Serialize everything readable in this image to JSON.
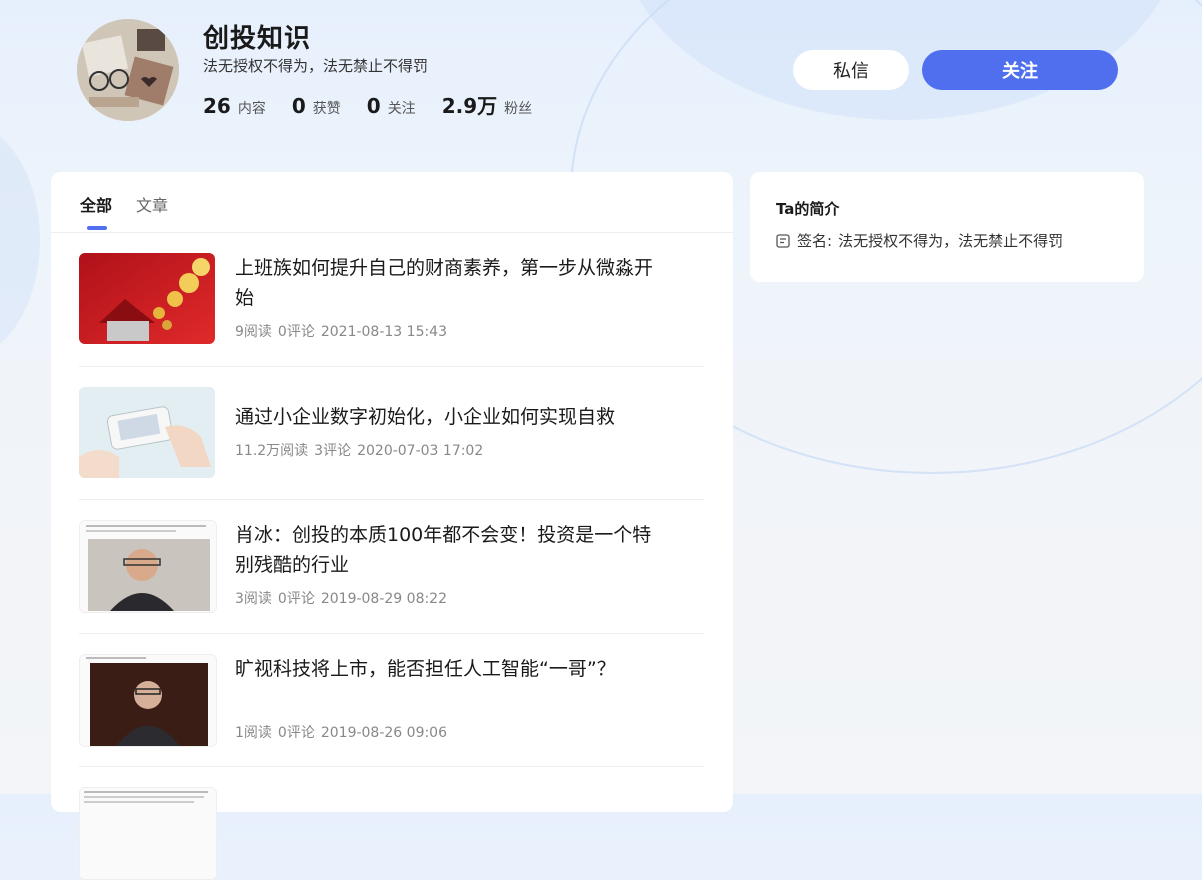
{
  "profile": {
    "name": "创投知识",
    "signature": "法无授权不得为，法无禁止不得罚",
    "stats": [
      {
        "value": "26",
        "label": "内容"
      },
      {
        "value": "0",
        "label": "获赞"
      },
      {
        "value": "0",
        "label": "关注"
      },
      {
        "value": "2.9万",
        "label": "粉丝"
      }
    ]
  },
  "actions": {
    "message_label": "私信",
    "follow_label": "关注"
  },
  "tabs": [
    {
      "label": "全部",
      "active": true
    },
    {
      "label": "文章",
      "active": false
    }
  ],
  "articles": [
    {
      "title": "上班族如何提升自己的财商素养，第一步从微淼开始",
      "reads": "9阅读",
      "comments": "0评论",
      "date": "2021-08-13 15:43",
      "thumb": "house-coins-icon"
    },
    {
      "title": "通过小企业数字初始化，小企业如何实现自救",
      "reads": "11.2万阅读",
      "comments": "3评论",
      "date": "2020-07-03 17:02",
      "thumb": "phone-hand-icon"
    },
    {
      "title": "肖冰：创投的本质100年都不会变！投资是一个特别残酷的行业",
      "reads": "3阅读",
      "comments": "0评论",
      "date": "2019-08-29 08:22",
      "thumb": "portrait-icon"
    },
    {
      "title": "旷视科技将上市，能否担任人工智能“一哥”？",
      "reads": "1阅读",
      "comments": "0评论",
      "date": "2019-08-26 09:06",
      "thumb": "portrait-icon"
    },
    {
      "title": "",
      "reads": "",
      "comments": "",
      "date": "",
      "thumb": "document-icon"
    }
  ],
  "sidebar": {
    "title": "Ta的简介",
    "signature_label": "签名:",
    "signature_value": "法无授权不得为，法无禁止不得罚"
  },
  "colors": {
    "accent": "#4f6fef",
    "background": "#eef4fb"
  }
}
